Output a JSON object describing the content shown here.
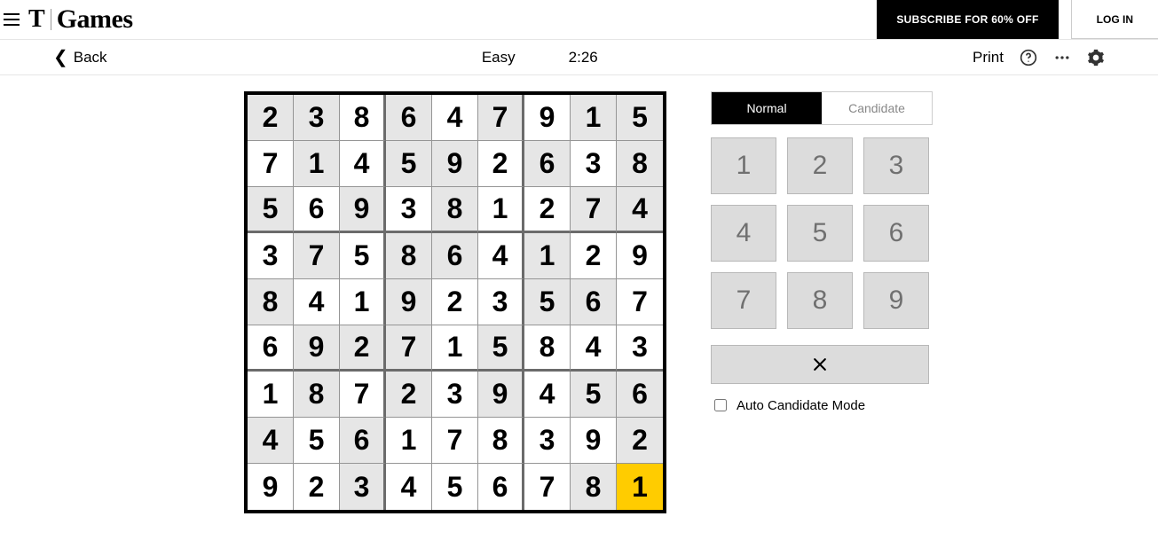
{
  "header": {
    "brand_letter": "T",
    "brand_text": "Games",
    "subscribe_label": "SUBSCRIBE FOR 60% OFF",
    "login_label": "LOG IN"
  },
  "toolbar": {
    "back_label": "Back",
    "difficulty": "Easy",
    "timer": "2:26",
    "print_label": "Print"
  },
  "sudoku": {
    "grid": [
      [
        {
          "v": 2,
          "g": true
        },
        {
          "v": 3,
          "g": true
        },
        {
          "v": 8,
          "g": false
        },
        {
          "v": 6,
          "g": true
        },
        {
          "v": 4,
          "g": false
        },
        {
          "v": 7,
          "g": true
        },
        {
          "v": 9,
          "g": false
        },
        {
          "v": 1,
          "g": true
        },
        {
          "v": 5,
          "g": true
        }
      ],
      [
        {
          "v": 7,
          "g": false
        },
        {
          "v": 1,
          "g": true
        },
        {
          "v": 4,
          "g": false
        },
        {
          "v": 5,
          "g": true
        },
        {
          "v": 9,
          "g": true
        },
        {
          "v": 2,
          "g": false
        },
        {
          "v": 6,
          "g": true
        },
        {
          "v": 3,
          "g": false
        },
        {
          "v": 8,
          "g": true
        }
      ],
      [
        {
          "v": 5,
          "g": true
        },
        {
          "v": 6,
          "g": false
        },
        {
          "v": 9,
          "g": true
        },
        {
          "v": 3,
          "g": false
        },
        {
          "v": 8,
          "g": true
        },
        {
          "v": 1,
          "g": false
        },
        {
          "v": 2,
          "g": false
        },
        {
          "v": 7,
          "g": true
        },
        {
          "v": 4,
          "g": true
        }
      ],
      [
        {
          "v": 3,
          "g": false
        },
        {
          "v": 7,
          "g": true
        },
        {
          "v": 5,
          "g": false
        },
        {
          "v": 8,
          "g": true
        },
        {
          "v": 6,
          "g": true
        },
        {
          "v": 4,
          "g": false
        },
        {
          "v": 1,
          "g": true
        },
        {
          "v": 2,
          "g": false
        },
        {
          "v": 9,
          "g": false
        }
      ],
      [
        {
          "v": 8,
          "g": true
        },
        {
          "v": 4,
          "g": false
        },
        {
          "v": 1,
          "g": false
        },
        {
          "v": 9,
          "g": true
        },
        {
          "v": 2,
          "g": false
        },
        {
          "v": 3,
          "g": false
        },
        {
          "v": 5,
          "g": true
        },
        {
          "v": 6,
          "g": true
        },
        {
          "v": 7,
          "g": false
        }
      ],
      [
        {
          "v": 6,
          "g": false
        },
        {
          "v": 9,
          "g": true
        },
        {
          "v": 2,
          "g": true
        },
        {
          "v": 7,
          "g": true
        },
        {
          "v": 1,
          "g": false
        },
        {
          "v": 5,
          "g": true
        },
        {
          "v": 8,
          "g": false
        },
        {
          "v": 4,
          "g": false
        },
        {
          "v": 3,
          "g": false
        }
      ],
      [
        {
          "v": 1,
          "g": false
        },
        {
          "v": 8,
          "g": true
        },
        {
          "v": 7,
          "g": false
        },
        {
          "v": 2,
          "g": true
        },
        {
          "v": 3,
          "g": false
        },
        {
          "v": 9,
          "g": true
        },
        {
          "v": 4,
          "g": false
        },
        {
          "v": 5,
          "g": true
        },
        {
          "v": 6,
          "g": true
        }
      ],
      [
        {
          "v": 4,
          "g": true
        },
        {
          "v": 5,
          "g": false
        },
        {
          "v": 6,
          "g": true
        },
        {
          "v": 1,
          "g": false
        },
        {
          "v": 7,
          "g": false
        },
        {
          "v": 8,
          "g": false
        },
        {
          "v": 3,
          "g": false
        },
        {
          "v": 9,
          "g": false
        },
        {
          "v": 2,
          "g": true
        }
      ],
      [
        {
          "v": 9,
          "g": false
        },
        {
          "v": 2,
          "g": false
        },
        {
          "v": 3,
          "g": true
        },
        {
          "v": 4,
          "g": false
        },
        {
          "v": 5,
          "g": false
        },
        {
          "v": 6,
          "g": false
        },
        {
          "v": 7,
          "g": false
        },
        {
          "v": 8,
          "g": true
        },
        {
          "v": 1,
          "g": false,
          "sel": true
        }
      ]
    ]
  },
  "panel": {
    "mode_normal": "Normal",
    "mode_candidate": "Candidate",
    "keys": [
      "1",
      "2",
      "3",
      "4",
      "5",
      "6",
      "7",
      "8",
      "9"
    ],
    "auto_label": "Auto Candidate Mode"
  }
}
